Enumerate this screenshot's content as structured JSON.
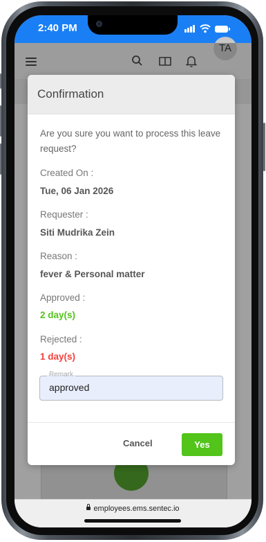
{
  "status_bar": {
    "time": "2:40 PM"
  },
  "header": {
    "avatar_initials": "TA",
    "icons": [
      "menu-icon",
      "search-icon",
      "book-icon",
      "bell-icon"
    ]
  },
  "modal": {
    "title": "Confirmation",
    "question": "Are you sure you want to process this leave request?",
    "fields": [
      {
        "label": "Created On :",
        "value": "Tue, 06 Jan 2026"
      },
      {
        "label": "Requester :",
        "value": "Siti Mudrika Zein"
      },
      {
        "label": "Reason :",
        "value": "fever & Personal matter"
      },
      {
        "label": "Approved :",
        "value": "2 day(s)"
      },
      {
        "label": "Rejected :",
        "value": "1 day(s)"
      }
    ],
    "remark": {
      "label": "Remark",
      "value": "approved"
    },
    "cancel_label": "Cancel",
    "yes_label": "Yes"
  },
  "browser": {
    "url": "employees.ems.sentec.io"
  },
  "colors": {
    "status_bar": "#1a7ff5",
    "approved": "#52c41a",
    "rejected": "#f5413c",
    "primary_button": "#52c41a",
    "remark_bg": "#e8eefc"
  }
}
